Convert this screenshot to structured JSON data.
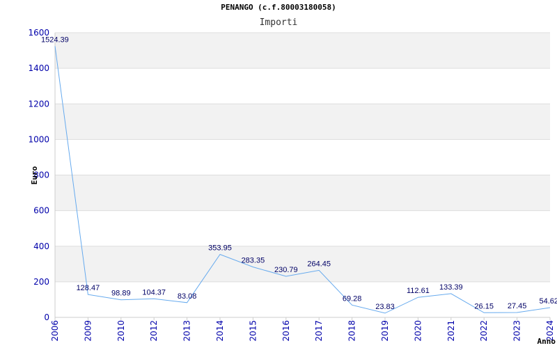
{
  "chart_data": {
    "type": "line",
    "title": "PENANGO (c.f.80003180058)",
    "subtitle": "Importi",
    "xlabel": "Anno",
    "ylabel": "Euro",
    "ylim": [
      0,
      1600
    ],
    "yticks": [
      "0",
      "200",
      "400",
      "600",
      "800",
      "1000",
      "1200",
      "1400",
      "1600"
    ],
    "grid": true,
    "line_color": "#66aaee",
    "categories": [
      "2006",
      "2009",
      "2010",
      "2012",
      "2013",
      "2014",
      "2015",
      "2016",
      "2017",
      "2018",
      "2019",
      "2020",
      "2021",
      "2022",
      "2023",
      "2024"
    ],
    "values": [
      1524.39,
      128.47,
      98.89,
      104.37,
      83.08,
      353.95,
      283.35,
      230.79,
      264.45,
      69.28,
      23.83,
      112.61,
      133.39,
      26.15,
      27.45,
      54.62
    ],
    "labels": [
      "1524.39",
      "128.47",
      "98.89",
      "104.37",
      "83.08",
      "353.95",
      "283.35",
      "230.79",
      "264.45",
      "69.28",
      "23.83",
      "112.61",
      "133.39",
      "26.15",
      "27.45",
      "54.62"
    ]
  }
}
